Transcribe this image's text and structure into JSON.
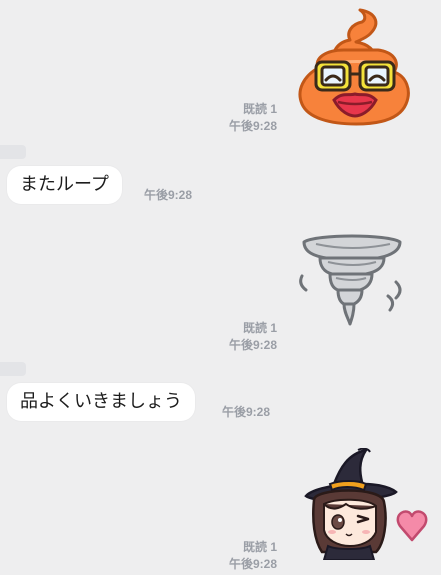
{
  "messages": [
    {
      "type": "sticker",
      "side": "sent",
      "sticker": "poop-with-glasses-sticker",
      "read": "既読 1",
      "time": "午後9:28"
    },
    {
      "type": "text",
      "side": "received",
      "text": "またループ",
      "time": "午後9:28"
    },
    {
      "type": "sticker",
      "side": "sent",
      "sticker": "tornado-sticker",
      "read": "既読 1",
      "time": "午後9:28"
    },
    {
      "type": "text",
      "side": "received",
      "text": "品よくいきましょう",
      "time": "午後9:28"
    },
    {
      "type": "sticker",
      "side": "sent",
      "sticker": "witch-girl-heart-sticker",
      "read": "既読 1",
      "time": "午後9:28"
    }
  ],
  "colors": {
    "background": "#eeeeef",
    "bubble": "#ffffff",
    "meta_text": "#9a9ea6"
  }
}
